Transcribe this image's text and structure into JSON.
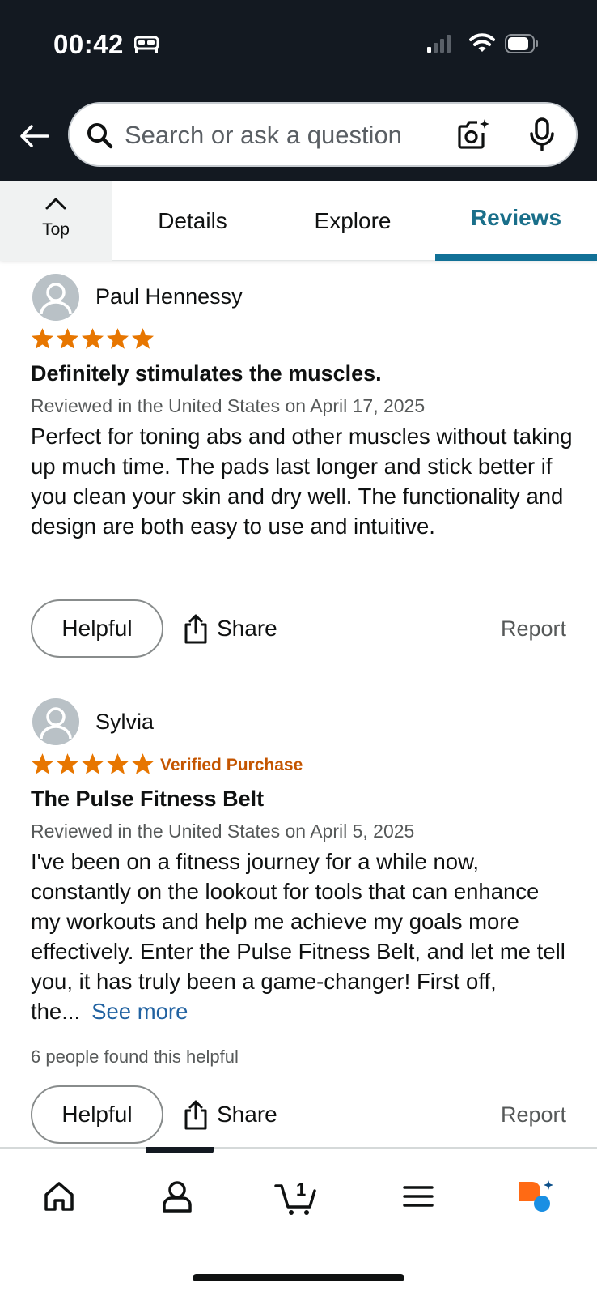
{
  "status_bar": {
    "time": "00:42"
  },
  "search": {
    "placeholder": "Search or ask a question"
  },
  "tabs": {
    "top_label": "Top",
    "details_label": "Details",
    "explore_label": "Explore",
    "reviews_label": "Reviews",
    "active": "Reviews"
  },
  "reviews": [
    {
      "name": "Paul Hennessy",
      "rating": 5,
      "verified": "",
      "title": "Definitely stimulates the muscles.",
      "date": "Reviewed in the United States on April 17, 2025",
      "body": "Perfect for toning abs and other muscles without taking up much time. The pads last longer and stick better if you clean your skin and dry well. The functionality and design are both easy to use and intuitive.",
      "helpful_count": "",
      "helpful_label": "Helpful",
      "share_label": "Share",
      "report_label": "Report"
    },
    {
      "name": "Sylvia",
      "rating": 5,
      "verified": "Verified Purchase",
      "title": "The Pulse Fitness Belt",
      "date": "Reviewed in the United States on April 5, 2025",
      "body": "I've been on a fitness journey for a while now, constantly on the lookout for tools that can enhance my workouts and help me achieve my goals more effectively. Enter the Pulse Fitness Belt, and let me tell you, it has truly been a game-changer! First off, the...",
      "see_more": "See more",
      "helpful_count": "6 people found this helpful",
      "helpful_label": "Helpful",
      "share_label": "Share",
      "report_label": "Report"
    }
  ],
  "bottom_nav": {
    "cart_count": "1",
    "items": [
      "home-icon",
      "account-icon",
      "cart-icon",
      "menu-icon",
      "rufus-icon"
    ]
  },
  "colors": {
    "header_bg": "#131921",
    "star": "#e77600",
    "verified": "#c45500",
    "reviews_tab": "#127197",
    "link": "#2162a1"
  }
}
